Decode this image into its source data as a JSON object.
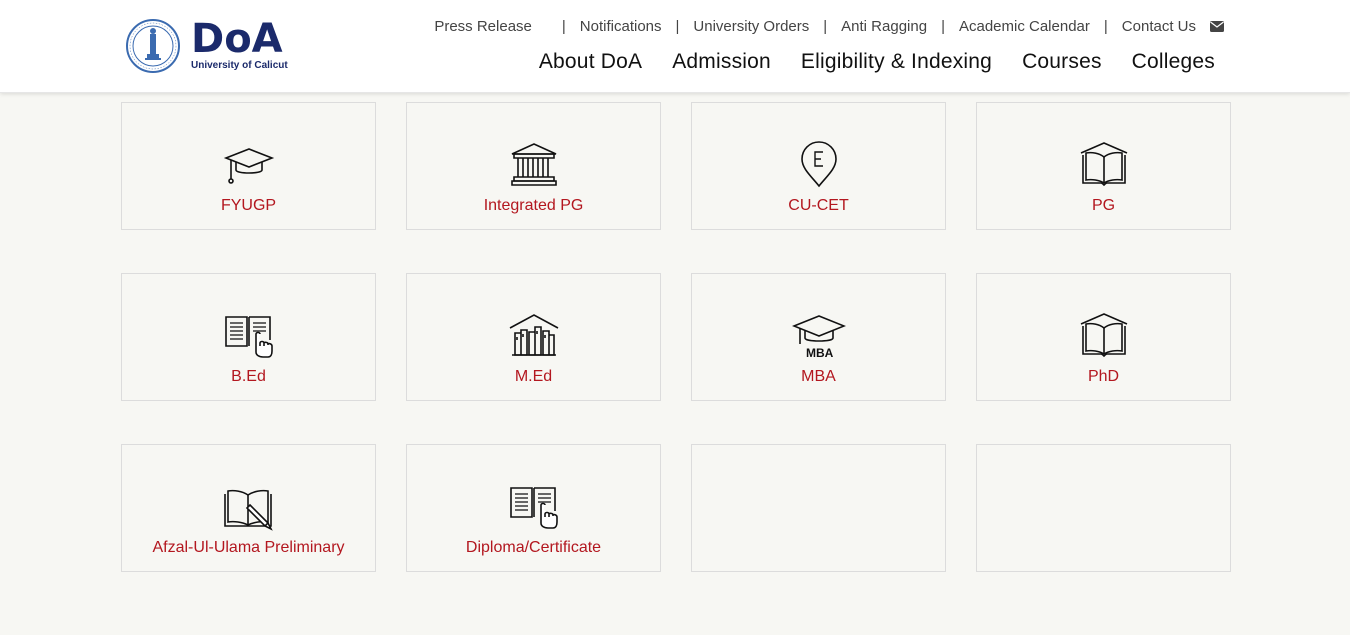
{
  "brand": {
    "title": "DoA",
    "subtitle": "University of Calicut"
  },
  "topnav": {
    "items": [
      {
        "label": "Press Release"
      },
      {
        "label": "Notifications"
      },
      {
        "label": "University Orders"
      },
      {
        "label": "Anti Ragging"
      },
      {
        "label": "Academic Calendar"
      },
      {
        "label": "Contact Us"
      }
    ],
    "contact_icon": "envelope-icon"
  },
  "mainnav": {
    "items": [
      {
        "label": "About DoA"
      },
      {
        "label": "Admission"
      },
      {
        "label": "Eligibility & Indexing"
      },
      {
        "label": "Courses"
      },
      {
        "label": "Colleges"
      }
    ]
  },
  "cards": [
    {
      "label": "FYUGP",
      "icon": "graduation-cap-icon"
    },
    {
      "label": "Integrated PG",
      "icon": "university-building-icon"
    },
    {
      "label": "CU-CET",
      "icon": "map-pin-e-icon"
    },
    {
      "label": "PG",
      "icon": "open-book-icon"
    },
    {
      "label": "B.Ed",
      "icon": "book-hand-pointer-icon"
    },
    {
      "label": "M.Ed",
      "icon": "library-books-icon"
    },
    {
      "label": "MBA",
      "icon": "mba-cap-icon",
      "icon_text": "MBA"
    },
    {
      "label": "PhD",
      "icon": "open-book-icon"
    },
    {
      "label": "Afzal-Ul-Ulama Preliminary",
      "icon": "book-pencil-icon"
    },
    {
      "label": "Diploma/Certificate",
      "icon": "book-hand-pointer-icon"
    }
  ],
  "colors": {
    "accent": "#b3171f",
    "brand": "#1b2a6b",
    "background": "#f7f7f3"
  }
}
